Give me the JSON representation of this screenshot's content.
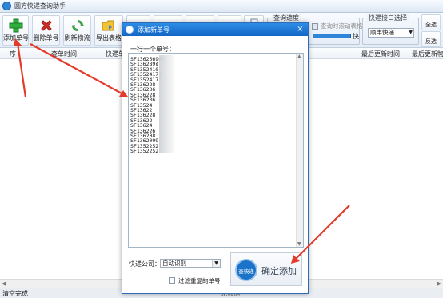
{
  "window": {
    "title": "圆方快递查询助手"
  },
  "toolbar": {
    "buttons": [
      {
        "label": "添加单号"
      },
      {
        "label": "删除单号"
      },
      {
        "label": "刷新物流"
      },
      {
        "label": "导出表格"
      }
    ],
    "query_speed": {
      "title": "查询速度",
      "fast_label": "快",
      "refresh_checkbox_label": "查询时滚动表格"
    },
    "express_select": {
      "title": "快递接口选择",
      "value": "顺丰快递"
    },
    "side_buttons": [
      {
        "label": "全选"
      },
      {
        "label": "反选"
      }
    ]
  },
  "grid": {
    "columns": [
      "序",
      "查单时间",
      "快递单",
      "最后更新时间",
      "最后更新物"
    ]
  },
  "status": {
    "left": "清空完成",
    "center": "无数据"
  },
  "dialog": {
    "title": "添加新单号",
    "close": "×",
    "prompt": "一行一个单号：",
    "numbers": [
      "SF136256964",
      "SF136289¢",
      "SF1352410",
      "SF1352417(",
      "SF1352417",
      "SF136228",
      "SF136236",
      "SF136228",
      "SF136236",
      "SF13524",
      "SF13622",
      "SF136228",
      "SF13622",
      "SF13624",
      "SF136226",
      "SF136208",
      "SF1362099",
      "SF1352252",
      "SF1352252"
    ],
    "company_label": "快递公司：",
    "company_value": "自动识别",
    "filter_label": "过滤重复的单号",
    "confirm_label": "确定添加",
    "confirm_icon_text": "查快递"
  },
  "colors": {
    "accent": "#1366c4",
    "arrow": "#e43a2a"
  }
}
